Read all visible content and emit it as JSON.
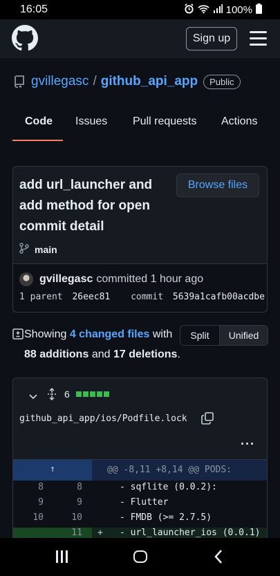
{
  "status_bar": {
    "time": "16:05",
    "battery": "100%"
  },
  "header": {
    "signup_label": "Sign up"
  },
  "repo": {
    "owner": "gvillegasc",
    "separator": "/",
    "name": "github_api_app",
    "visibility": "Public"
  },
  "tabs": [
    {
      "label": "Code",
      "active": true
    },
    {
      "label": "Issues"
    },
    {
      "label": "Pull requests"
    },
    {
      "label": "Actions"
    }
  ],
  "commit": {
    "title": "add url_launcher and add method for open commit detail",
    "browse_label": "Browse files",
    "branch": "main",
    "author": "gvillegasc",
    "committed_text": "committed 1 hour ago",
    "parent_label": "1 parent",
    "parent_hash": "26eec81",
    "commit_label": "commit",
    "commit_hash": "5639a1cafb00acdbe"
  },
  "summary": {
    "showing": "Showing",
    "changed_files": "4 changed files",
    "with": "with",
    "additions": "88 additions",
    "and": "and",
    "deletions": "17 deletions",
    "period": ".",
    "split_label": "Split",
    "unified_label": "Unified"
  },
  "file": {
    "change_count": "6",
    "path": "github_api_app/ios/Podfile.lock",
    "kebab": "···",
    "expand_glyph": "↑",
    "hunk_header": "@@ -8,11 +8,14 @@ PODS:",
    "lines": [
      {
        "old": "8",
        "new": "8",
        "sign": "",
        "code": "- sqflite (0.0.2):"
      },
      {
        "old": "9",
        "new": "9",
        "sign": "",
        "code": "  - Flutter"
      },
      {
        "old": "10",
        "new": "10",
        "sign": "",
        "code": "  - FMDB (>= 2.7.5)"
      },
      {
        "old": "",
        "new": "11",
        "sign": "+",
        "code": "- url_launcher_ios (0.0.1)"
      }
    ]
  },
  "colors": {
    "accent_link": "#58a6ff",
    "tab_underline": "#f78166",
    "diffstat_green": "#3fb950"
  }
}
